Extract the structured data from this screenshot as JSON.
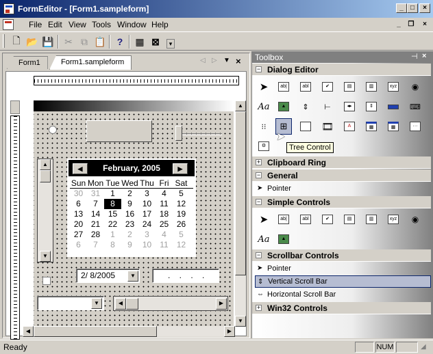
{
  "window": {
    "title": "FormEditor - [Form1.sampleform]"
  },
  "menu": [
    "File",
    "Edit",
    "View",
    "Tools",
    "Window",
    "Help"
  ],
  "tabs": [
    "Form1",
    "Form1.sampleform"
  ],
  "form": {
    "date_value": "2/ 8/2005",
    "time_value": ". . . ."
  },
  "calendar": {
    "month_label": "February, 2005",
    "weekdays": [
      "Sun",
      "Mon",
      "Tue",
      "Wed",
      "Thu",
      "Fri",
      "Sat"
    ],
    "weeks": [
      [
        "30",
        "31",
        "1",
        "2",
        "3",
        "4",
        "5"
      ],
      [
        "6",
        "7",
        "8",
        "9",
        "10",
        "11",
        "12"
      ],
      [
        "13",
        "14",
        "15",
        "16",
        "17",
        "18",
        "19"
      ],
      [
        "20",
        "21",
        "22",
        "23",
        "24",
        "25",
        "26"
      ],
      [
        "27",
        "28",
        "1",
        "2",
        "3",
        "4",
        "5"
      ],
      [
        "6",
        "7",
        "8",
        "9",
        "10",
        "11",
        "12"
      ]
    ],
    "selected_day": "8"
  },
  "toolbox": {
    "title": "Toolbox",
    "groups": {
      "dialog_editor": "Dialog Editor",
      "clipboard_ring": "Clipboard Ring",
      "general": "General",
      "simple_controls": "Simple Controls",
      "scrollbar_controls": "Scrollbar Controls",
      "win32_controls": "Win32 Controls"
    },
    "general_items": [
      "Pointer"
    ],
    "scrollbar_items": [
      "Pointer",
      "Vertical Scroll Bar",
      "Horizontal Scroll Bar"
    ],
    "tooltip": "Tree Control"
  },
  "status": {
    "text": "Ready",
    "num": "NUM"
  }
}
